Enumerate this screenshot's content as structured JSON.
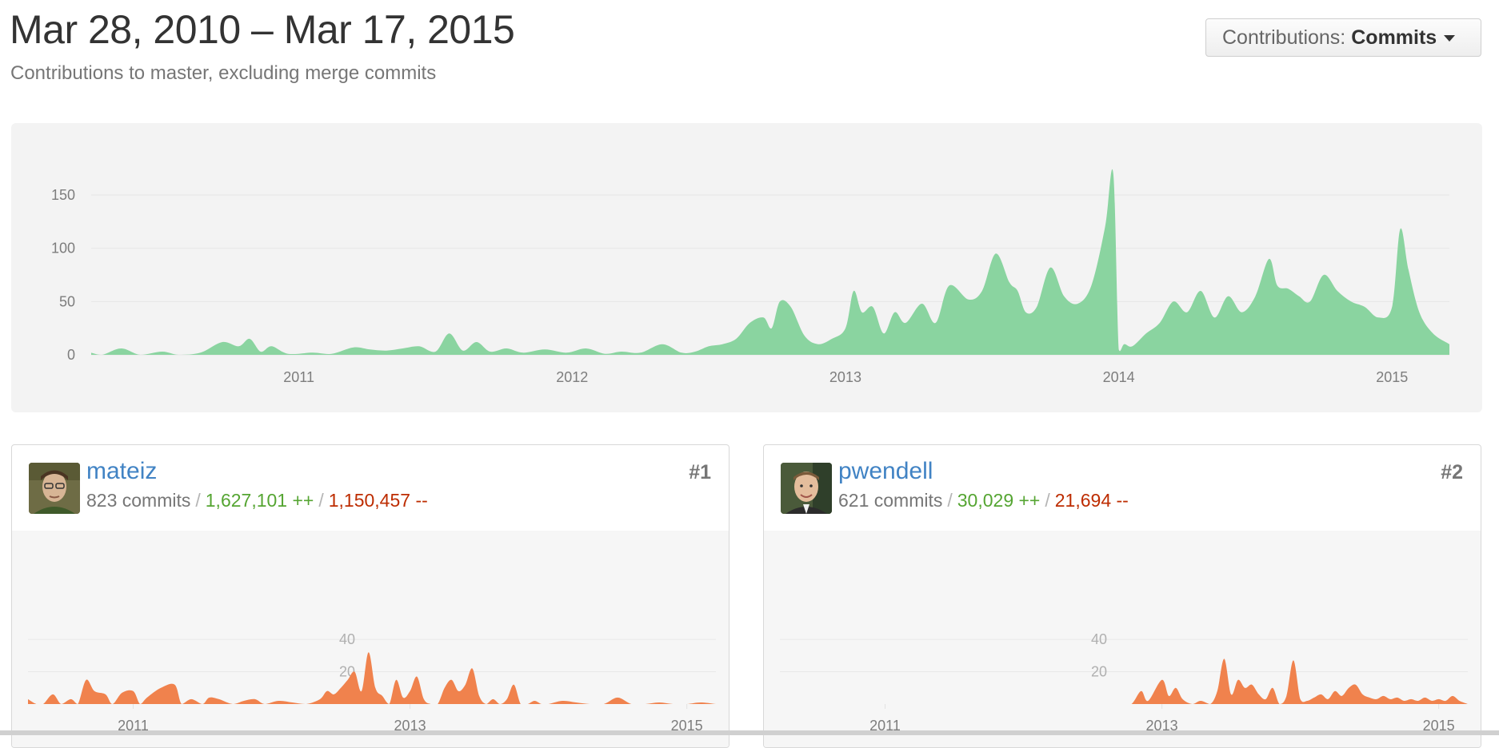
{
  "header": {
    "title": "Mar 28, 2010 – Mar 17, 2015",
    "subtitle": "Contributions to master, excluding merge commits",
    "dropdown_prefix": "Contributions:",
    "dropdown_value": "Commits"
  },
  "colors": {
    "main_area": "#8ad4a0",
    "contributor_area": "#f0824d",
    "link": "#4183c4",
    "additions": "#55a532",
    "deletions": "#bd2c00"
  },
  "chart_data": [
    {
      "type": "area",
      "ylabel": "",
      "ylim": [
        0,
        180
      ],
      "yticks": [
        0,
        50,
        100,
        150
      ],
      "xlim": [
        2010.24,
        2015.21
      ],
      "xticks": [
        2011,
        2012,
        2013,
        2014,
        2015
      ],
      "grid": true,
      "x": [
        2010.24,
        2010.28,
        2010.35,
        2010.42,
        2010.5,
        2010.56,
        2010.64,
        2010.72,
        2010.78,
        2010.82,
        2010.86,
        2010.9,
        2010.96,
        2011.05,
        2011.12,
        2011.2,
        2011.26,
        2011.32,
        2011.38,
        2011.44,
        2011.5,
        2011.55,
        2011.6,
        2011.65,
        2011.7,
        2011.76,
        2011.82,
        2011.9,
        2011.98,
        2012.05,
        2012.12,
        2012.18,
        2012.25,
        2012.33,
        2012.4,
        2012.45,
        2012.5,
        2012.55,
        2012.6,
        2012.65,
        2012.7,
        2012.73,
        2012.76,
        2012.8,
        2012.85,
        2012.9,
        2012.95,
        2013.0,
        2013.03,
        2013.06,
        2013.1,
        2013.14,
        2013.18,
        2013.22,
        2013.28,
        2013.33,
        2013.38,
        2013.45,
        2013.5,
        2013.55,
        2013.6,
        2013.63,
        2013.66,
        2013.7,
        2013.75,
        2013.8,
        2013.85,
        2013.9,
        2013.95,
        2013.98,
        2014.0,
        2014.02,
        2014.05,
        2014.1,
        2014.15,
        2014.2,
        2014.25,
        2014.3,
        2014.35,
        2014.4,
        2014.45,
        2014.5,
        2014.55,
        2014.58,
        2014.62,
        2014.66,
        2014.7,
        2014.75,
        2014.8,
        2014.85,
        2014.9,
        2014.95,
        2015.0,
        2015.03,
        2015.06,
        2015.1,
        2015.15,
        2015.21
      ],
      "series": [
        {
          "values": [
            2,
            0,
            6,
            0,
            3,
            0,
            2,
            12,
            8,
            15,
            3,
            8,
            1,
            2,
            1,
            7,
            5,
            4,
            6,
            8,
            3,
            20,
            4,
            12,
            3,
            6,
            2,
            5,
            2,
            6,
            1,
            3,
            2,
            10,
            2,
            3,
            8,
            10,
            15,
            30,
            35,
            25,
            50,
            45,
            18,
            10,
            15,
            25,
            60,
            40,
            45,
            20,
            40,
            30,
            48,
            30,
            65,
            52,
            60,
            95,
            68,
            60,
            40,
            45,
            82,
            55,
            48,
            65,
            120,
            170,
            5,
            10,
            8,
            20,
            30,
            50,
            40,
            60,
            35,
            55,
            40,
            55,
            90,
            65,
            62,
            55,
            50,
            75,
            60,
            50,
            45,
            35,
            45,
            118,
            80,
            40,
            20,
            10
          ]
        }
      ]
    },
    {
      "type": "area",
      "ylabel": "",
      "ylim": [
        0,
        45
      ],
      "yticks": [
        20,
        40
      ],
      "xlim": [
        2010.24,
        2015.21
      ],
      "xticks": [
        2011,
        2013,
        2015
      ],
      "grid": true,
      "x": [
        2010.24,
        2010.3,
        2010.35,
        2010.42,
        2010.48,
        2010.55,
        2010.6,
        2010.66,
        2010.72,
        2010.8,
        2010.85,
        2010.92,
        2011.0,
        2011.05,
        2011.1,
        2011.2,
        2011.3,
        2011.35,
        2011.42,
        2011.5,
        2011.55,
        2011.62,
        2011.72,
        2011.8,
        2011.88,
        2011.95,
        2012.05,
        2012.15,
        2012.25,
        2012.35,
        2012.4,
        2012.45,
        2012.5,
        2012.55,
        2012.6,
        2012.65,
        2012.7,
        2012.75,
        2012.8,
        2012.85,
        2012.9,
        2012.95,
        2013.0,
        2013.05,
        2013.1,
        2013.15,
        2013.2,
        2013.25,
        2013.3,
        2013.35,
        2013.4,
        2013.45,
        2013.5,
        2013.55,
        2013.6,
        2013.65,
        2013.7,
        2013.75,
        2013.8,
        2013.85,
        2013.9,
        2013.95,
        2014.0,
        2014.1,
        2014.2,
        2014.3,
        2014.4,
        2014.5,
        2014.6,
        2014.7,
        2014.8,
        2014.9,
        2015.0,
        2015.1,
        2015.21
      ],
      "series": [
        {
          "values": [
            3,
            0,
            0,
            6,
            0,
            3,
            0,
            15,
            8,
            6,
            0,
            7,
            8,
            0,
            4,
            10,
            12,
            0,
            3,
            0,
            4,
            3,
            0,
            2,
            3,
            0,
            2,
            1,
            0,
            3,
            8,
            6,
            10,
            15,
            20,
            8,
            32,
            10,
            5,
            0,
            15,
            4,
            8,
            17,
            3,
            0,
            0,
            10,
            15,
            8,
            12,
            22,
            5,
            0,
            3,
            0,
            3,
            12,
            0,
            0,
            2,
            0,
            0,
            2,
            1,
            0,
            0,
            4,
            0,
            0,
            1,
            0,
            0,
            1,
            0
          ]
        }
      ]
    },
    {
      "type": "area",
      "ylabel": "",
      "ylim": [
        0,
        45
      ],
      "yticks": [
        20,
        40
      ],
      "xlim": [
        2010.24,
        2015.21
      ],
      "xticks": [
        2011,
        2013,
        2015
      ],
      "grid": true,
      "x": [
        2010.24,
        2012.0,
        2012.5,
        2012.7,
        2012.78,
        2012.85,
        2012.9,
        2013.0,
        2013.05,
        2013.1,
        2013.15,
        2013.22,
        2013.28,
        2013.35,
        2013.4,
        2013.45,
        2013.5,
        2013.55,
        2013.6,
        2013.65,
        2013.7,
        2013.75,
        2013.8,
        2013.85,
        2013.9,
        2013.95,
        2014.0,
        2014.05,
        2014.1,
        2014.15,
        2014.2,
        2014.25,
        2014.3,
        2014.35,
        2014.4,
        2014.45,
        2014.5,
        2014.55,
        2014.6,
        2014.65,
        2014.7,
        2014.75,
        2014.8,
        2014.85,
        2014.9,
        2014.95,
        2015.0,
        2015.05,
        2015.1,
        2015.15,
        2015.21
      ],
      "series": [
        {
          "values": [
            0,
            0,
            0,
            0,
            0,
            8,
            2,
            15,
            5,
            10,
            3,
            0,
            2,
            0,
            8,
            28,
            6,
            15,
            10,
            12,
            6,
            3,
            10,
            0,
            5,
            27,
            3,
            2,
            4,
            6,
            3,
            8,
            5,
            10,
            12,
            6,
            4,
            3,
            5,
            3,
            4,
            2,
            3,
            2,
            4,
            2,
            3,
            2,
            5,
            2,
            0
          ]
        }
      ]
    }
  ],
  "contributors": [
    {
      "name": "mateiz",
      "commits": "823 commits",
      "additions": "1,627,101 ++",
      "deletions": "1,150,457 --",
      "rank": "#1"
    },
    {
      "name": "pwendell",
      "commits": "621 commits",
      "additions": "30,029 ++",
      "deletions": "21,694 --",
      "rank": "#2"
    }
  ]
}
